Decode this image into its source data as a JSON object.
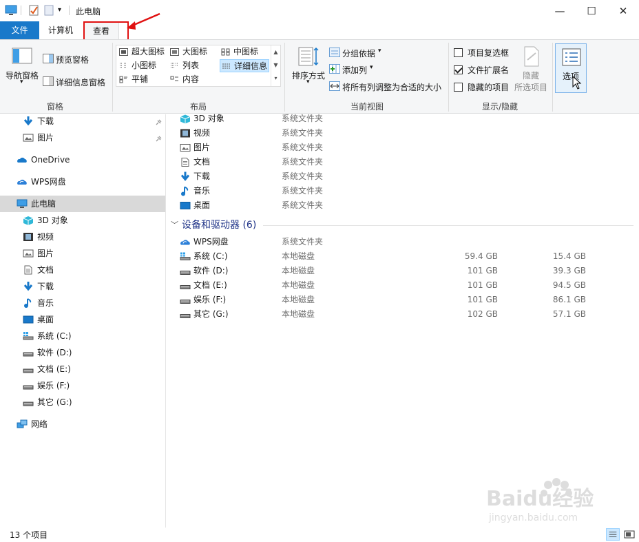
{
  "window": {
    "title": "此电脑",
    "minimize": "—",
    "maximize": "☐",
    "close": "✕"
  },
  "tabs": {
    "file": "文件",
    "computer": "计算机",
    "view": "查看"
  },
  "ribbon": {
    "panes": {
      "label": "窗格",
      "nav_pane": "导航窗格",
      "preview_pane": "预览窗格",
      "details_pane": "详细信息窗格"
    },
    "layout": {
      "label": "布局",
      "items": [
        "超大图标",
        "大图标",
        "中图标",
        "小图标",
        "列表",
        "详细信息",
        "平铺",
        "内容"
      ],
      "selected": "详细信息"
    },
    "current_view": {
      "label": "当前视图",
      "sort_by": "排序方式",
      "group_by": "分组依据",
      "add_columns": "添加列",
      "size_all_columns": "将所有列调整为合适的大小"
    },
    "show_hide": {
      "label": "显示/隐藏",
      "item_checkboxes": "项目复选框",
      "item_checkboxes_checked": false,
      "file_extensions": "文件扩展名",
      "file_extensions_checked": true,
      "hidden_items": "隐藏的项目",
      "hidden_items_checked": false,
      "hide_selected_line1": "隐藏",
      "hide_selected_line2": "所选项目"
    },
    "options": "选项"
  },
  "nav": {
    "quick_items": [
      {
        "label": "下载",
        "icon": "download-icon"
      },
      {
        "label": "图片",
        "icon": "pictures-icon"
      }
    ],
    "onedrive": "OneDrive",
    "wps": "WPS网盘",
    "this_pc": "此电脑",
    "pc_items": [
      {
        "label": "3D 对象",
        "icon": "3d-objects-icon"
      },
      {
        "label": "视频",
        "icon": "video-icon"
      },
      {
        "label": "图片",
        "icon": "pictures-icon"
      },
      {
        "label": "文档",
        "icon": "documents-icon"
      },
      {
        "label": "下载",
        "icon": "download-icon"
      },
      {
        "label": "音乐",
        "icon": "music-icon"
      },
      {
        "label": "桌面",
        "icon": "desktop-icon"
      },
      {
        "label": "系统 (C:)",
        "icon": "system-drive-icon"
      },
      {
        "label": "软件 (D:)",
        "icon": "drive-icon"
      },
      {
        "label": "文档 (E:)",
        "icon": "drive-icon"
      },
      {
        "label": "娱乐 (F:)",
        "icon": "drive-icon"
      },
      {
        "label": "其它 (G:)",
        "icon": "drive-icon"
      }
    ],
    "network": "网络"
  },
  "content": {
    "folders": [
      {
        "name": "3D 对象",
        "type": "系统文件夹",
        "icon": "3d-objects-icon"
      },
      {
        "name": "视频",
        "type": "系统文件夹",
        "icon": "video-icon"
      },
      {
        "name": "图片",
        "type": "系统文件夹",
        "icon": "pictures-icon"
      },
      {
        "name": "文档",
        "type": "系统文件夹",
        "icon": "documents-icon"
      },
      {
        "name": "下载",
        "type": "系统文件夹",
        "icon": "download-icon"
      },
      {
        "name": "音乐",
        "type": "系统文件夹",
        "icon": "music-icon"
      },
      {
        "name": "桌面",
        "type": "系统文件夹",
        "icon": "desktop-icon"
      }
    ],
    "devices_header": "设备和驱动器 (6)",
    "devices": [
      {
        "name": "WPS网盘",
        "type": "系统文件夹",
        "total": "",
        "free": "",
        "icon": "wps-cloud-icon"
      },
      {
        "name": "系统 (C:)",
        "type": "本地磁盘",
        "total": "59.4 GB",
        "free": "15.4 GB",
        "icon": "system-drive-icon"
      },
      {
        "name": "软件 (D:)",
        "type": "本地磁盘",
        "total": "101 GB",
        "free": "39.3 GB",
        "icon": "drive-icon"
      },
      {
        "name": "文档 (E:)",
        "type": "本地磁盘",
        "total": "101 GB",
        "free": "94.5 GB",
        "icon": "drive-icon"
      },
      {
        "name": "娱乐 (F:)",
        "type": "本地磁盘",
        "total": "101 GB",
        "free": "86.1 GB",
        "icon": "drive-icon"
      },
      {
        "name": "其它 (G:)",
        "type": "本地磁盘",
        "total": "102 GB",
        "free": "57.1 GB",
        "icon": "drive-icon"
      }
    ]
  },
  "status": {
    "item_count": "13 个项目"
  },
  "watermark": {
    "brand": "Baidu经验",
    "url": "jingyan.baidu.com"
  },
  "colors": {
    "accent": "#1979ca",
    "highlight_red": "#e01010",
    "selected_bg": "#cce8ff",
    "group_header": "#1e3287"
  }
}
